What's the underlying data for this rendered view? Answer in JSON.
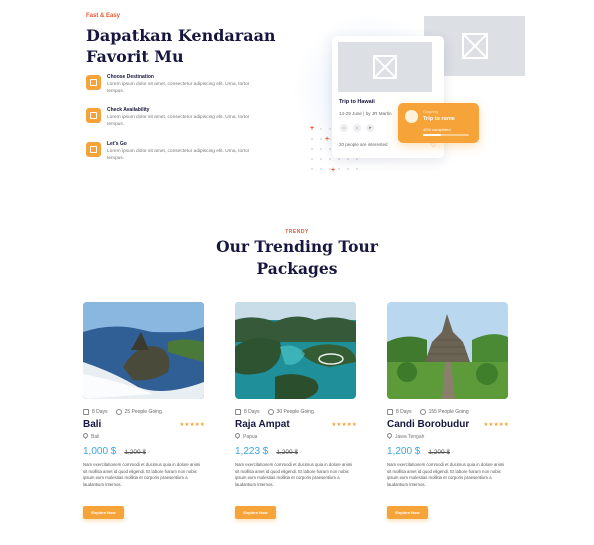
{
  "hero": {
    "tagline": "Fast & Easy",
    "title": "Dapatkan Kendaraan Favorit Mu",
    "features": [
      {
        "title": "Choose Destination",
        "desc": "Lorem ipsum dolor sit amet, consectetur adipiscing elit. Urna, tortor tempus.",
        "icon": "map-icon"
      },
      {
        "title": "Check Availability",
        "desc": "Lorem ipsum dolor sit amet, consectetur adipiscing elit. Urna, tortor tempus.",
        "icon": "chart-icon"
      },
      {
        "title": "Let's Go",
        "desc": "Lorem ipsum dolor sit amet, consectetur adipiscing elit. Urna, tortor tempus.",
        "icon": "car-icon"
      }
    ]
  },
  "preview": {
    "hawaii": {
      "title": "Trip to Hawaii",
      "date": "14-29 June | by JR Martin",
      "people": "20 people are interested"
    },
    "rome": {
      "small": "Ongoing",
      "title": "Trip to rome",
      "progress_text": "40% completed",
      "progress": 0.4
    }
  },
  "trending": {
    "tag": "TRENDY",
    "title": "Our Trending Tour Packages",
    "tours": [
      {
        "days": "8 Days",
        "people": "25 People Going",
        "name": "Bali",
        "stars": "★★★★★",
        "location": "Bali",
        "price": "1,000 $",
        "old_price": "1,200 $",
        "desc": "Nam exercitationem commodi et ducimus quia in dolore animi sit mollitia amet id quod eligendi. Et labore harum non nobis ipsum eum molestias mollitia et corporis praesentium a laudantium internos.",
        "button": "Explore Now"
      },
      {
        "days": "8 Days",
        "people": "30 People Going",
        "name": "Raja Ampat",
        "stars": "★★★★★",
        "location": "Papua",
        "price": "1,223 $",
        "old_price": "1,200 $",
        "desc": "Nam exercitationem commodi et ducimus quia in dolore animi sit mollitia amet id quod eligendi. Et labore harum non nobis ipsum eum molestias mollitia et corporis praesentium a laudantium internos.",
        "button": "Explore Now"
      },
      {
        "days": "8 Days",
        "people": "155 People Going",
        "name": "Candi Borobudur",
        "stars": "★★★★★",
        "location": "Jawa Tengah",
        "price": "1,200 $",
        "old_price": "1,200 $",
        "desc": "Nam exercitationem commodi et ducimus quia in dolore animi sit mollitia amet id quod eligendi. Et labore harum non nobis ipsum eum molestias mollitia et corporis praesentium a laudantium internos.",
        "button": "Explore Now"
      }
    ]
  },
  "colors": {
    "accent": "#f6a33a",
    "brand_red": "#e8572e",
    "price_blue": "#3ba4dd",
    "navy": "#17163f"
  }
}
